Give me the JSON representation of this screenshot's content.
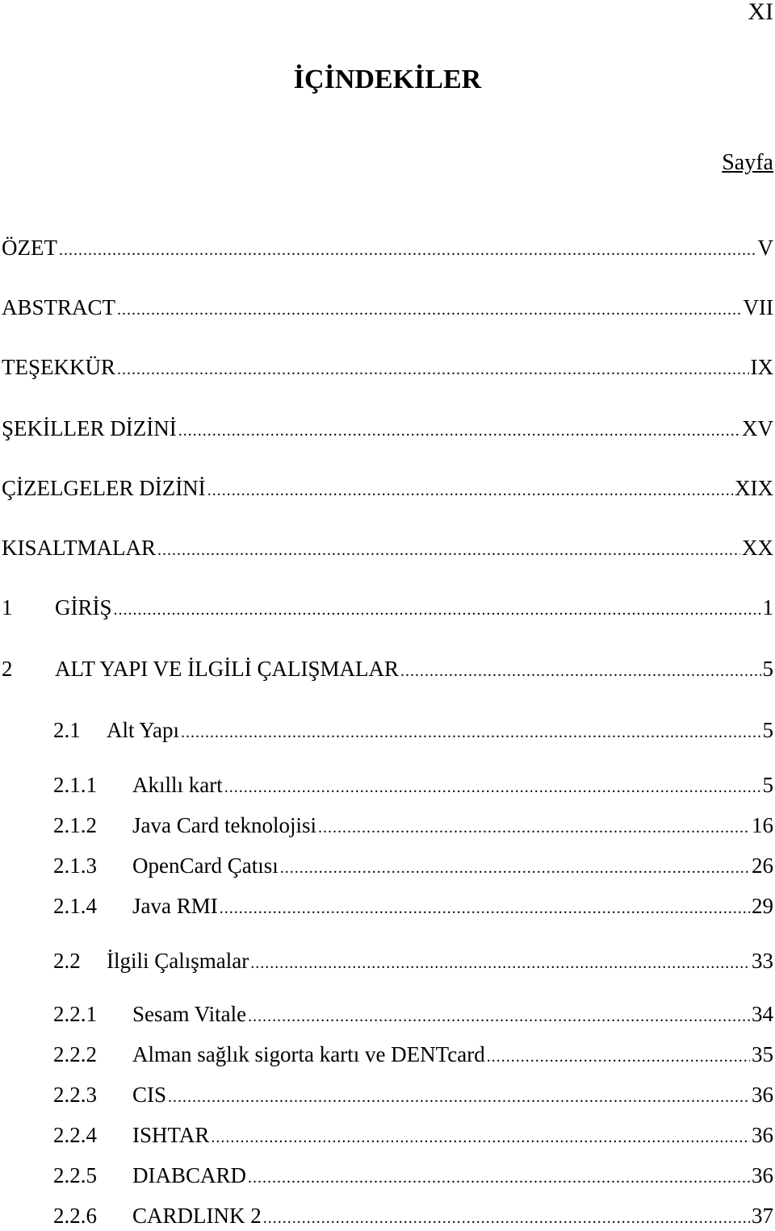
{
  "header": {
    "page_number": "XI",
    "title": "İÇİNDEKİLER",
    "page_column_label": "Sayfa"
  },
  "toc": [
    {
      "level": 0,
      "number": "",
      "label": "ÖZET",
      "page": "V"
    },
    {
      "level": 0,
      "number": "",
      "label": "ABSTRACT",
      "page": "VII"
    },
    {
      "level": 0,
      "number": "",
      "label": "TEŞEKKÜR",
      "page": "IX"
    },
    {
      "level": 0,
      "number": "",
      "label": "ŞEKİLLER DİZİNİ",
      "page": "XV"
    },
    {
      "level": 0,
      "number": "",
      "label": "ÇİZELGELER DİZİNİ",
      "page": "XIX"
    },
    {
      "level": 0,
      "number": "",
      "label": "KISALTMALAR",
      "page": "XX"
    },
    {
      "level": 1,
      "number": "1",
      "label": "GİRİŞ",
      "page": "1"
    },
    {
      "level": 1,
      "number": "2",
      "label": "ALT YAPI VE İLGİLİ ÇALIŞMALAR",
      "page": "5"
    },
    {
      "level": 2,
      "number": "2.1",
      "label": "Alt Yapı",
      "page": "5"
    },
    {
      "level": 3,
      "number": "2.1.1",
      "label": "Akıllı kart",
      "page": "5"
    },
    {
      "level": 3,
      "number": "2.1.2",
      "label": "Java Card teknolojisi",
      "page": "16"
    },
    {
      "level": 3,
      "number": "2.1.3",
      "label": "OpenCard Çatısı",
      "page": "26"
    },
    {
      "level": 3,
      "number": "2.1.4",
      "label": "Java RMI",
      "page": "29"
    },
    {
      "level": 2,
      "number": "2.2",
      "label": "İlgili Çalışmalar",
      "page": "33"
    },
    {
      "level": 3,
      "number": "2.2.1",
      "label": "Sesam Vitale",
      "page": "34"
    },
    {
      "level": 3,
      "number": "2.2.2",
      "label": "Alman sağlık sigorta kartı ve DENTcard",
      "page": "35"
    },
    {
      "level": 3,
      "number": "2.2.3",
      "label": "CIS",
      "page": "36"
    },
    {
      "level": 3,
      "number": "2.2.4",
      "label": "ISHTAR",
      "page": "36"
    },
    {
      "level": 3,
      "number": "2.2.5",
      "label": "DIABCARD",
      "page": "36"
    },
    {
      "level": 3,
      "number": "2.2.6",
      "label": "CARDLINK 2",
      "page": "37"
    }
  ]
}
